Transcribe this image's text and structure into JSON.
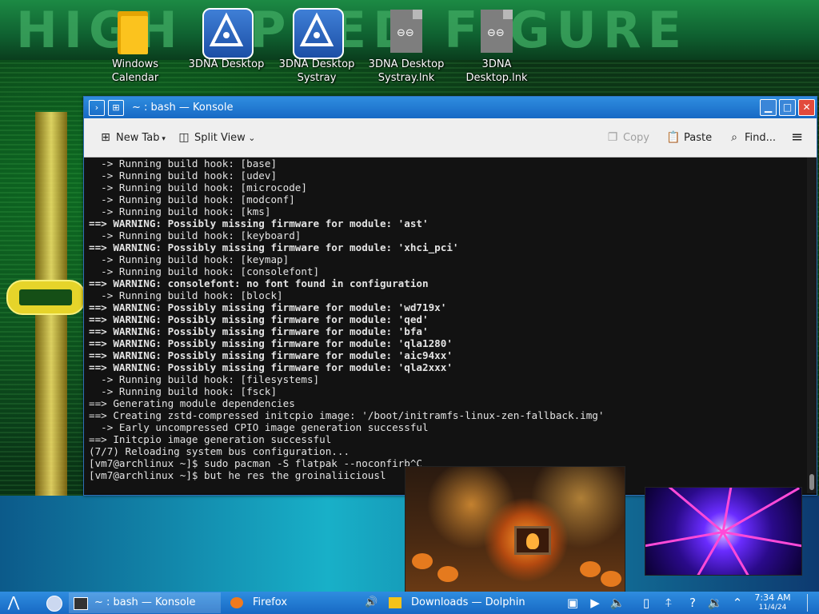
{
  "wallpaper": {
    "banner_text": "HIGH SPEED FIGURE"
  },
  "desktop_icons": [
    {
      "label": "Windows Calendar",
      "icon": "folder-icon"
    },
    {
      "label": "3DNA Desktop",
      "icon": "3dna-app-icon"
    },
    {
      "label": "3DNA Desktop Systray",
      "icon": "3dna-app-icon"
    },
    {
      "label": "3DNA Desktop Systray.lnk",
      "icon": "shortcut-file-icon"
    },
    {
      "label": "3DNA Desktop.lnk",
      "icon": "shortcut-file-icon"
    }
  ],
  "window": {
    "title": "~ : bash — Konsole",
    "toolbar": {
      "new_tab": "New Tab",
      "split_view": "Split View",
      "copy": "Copy",
      "paste": "Paste",
      "find": "Find...",
      "menu_icon": "hamburger-menu-icon"
    }
  },
  "terminal_lines": [
    "  -> Running build hook: [base]",
    "  -> Running build hook: [udev]",
    "  -> Running build hook: [microcode]",
    "  -> Running build hook: [modconf]",
    "  -> Running build hook: [kms]",
    "==> WARNING: Possibly missing firmware for module: 'ast'",
    "  -> Running build hook: [keyboard]",
    "==> WARNING: Possibly missing firmware for module: 'xhci_pci'",
    "  -> Running build hook: [keymap]",
    "  -> Running build hook: [consolefont]",
    "==> WARNING: consolefont: no font found in configuration",
    "  -> Running build hook: [block]",
    "==> WARNING: Possibly missing firmware for module: 'wd719x'",
    "==> WARNING: Possibly missing firmware for module: 'qed'",
    "==> WARNING: Possibly missing firmware for module: 'bfa'",
    "==> WARNING: Possibly missing firmware for module: 'qla1280'",
    "==> WARNING: Possibly missing firmware for module: 'aic94xx'",
    "==> WARNING: Possibly missing firmware for module: 'qla2xxx'",
    "  -> Running build hook: [filesystems]",
    "  -> Running build hook: [fsck]",
    "==> Generating module dependencies",
    "==> Creating zstd-compressed initcpio image: '/boot/initramfs-linux-zen-fallback.img'",
    "  -> Early uncompressed CPIO image generation successful",
    "==> Initcpio image generation successful",
    "(7/7) Reloading system bus configuration...",
    "[vm7@archlinux ~]$ sudo pacman -S flatpak --noconfirb^C",
    "[vm7@archlinux ~]$ but he res the groinaliiciousl"
  ],
  "taskbar": {
    "start_icon": "app-launcher-icon",
    "items": [
      {
        "label": "~ : bash — Konsole",
        "icon": "terminal-icon"
      },
      {
        "label": "Firefox",
        "icon": "firefox-icon"
      },
      {
        "label": "Downloads — Dolphin",
        "icon": "folder-icon"
      }
    ],
    "clock": {
      "time": "7:34 AM",
      "date": "11/4/24"
    }
  }
}
